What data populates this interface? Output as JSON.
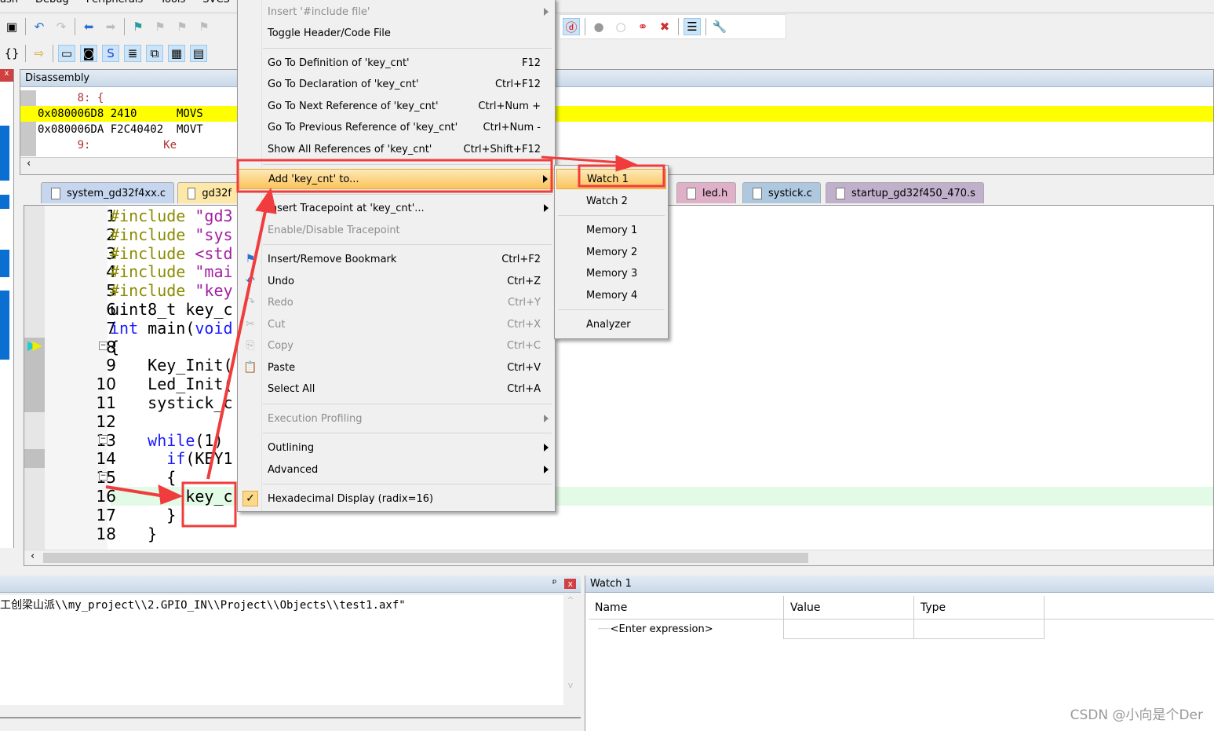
{
  "menubar": [
    "ash",
    "Debug",
    "Peripherals",
    "Tools",
    "SVCS"
  ],
  "disassembly": {
    "title": "Disassembly",
    "lines": [
      {
        "text": "      8: {",
        "style": "src"
      },
      {
        "text": "0x080006D8 2410      MOVS",
        "style": "current"
      },
      {
        "text": "0x080006DA F2C40402  MOVT",
        "style": "normal"
      },
      {
        "text": "      9:           Ke",
        "style": "src"
      }
    ]
  },
  "tabs": [
    {
      "label": "system_gd32f4xx.c",
      "color": "#c6d6ef"
    },
    {
      "label": "gd32f",
      "color": "#fde8a8"
    },
    {
      "label": "led.h",
      "color": "#dfb0c8"
    },
    {
      "label": "systick.c",
      "color": "#aec9df"
    },
    {
      "label": "startup_gd32f450_470.s",
      "color": "#c1b0cc"
    }
  ],
  "editor": {
    "lines": [
      {
        "n": "1",
        "parts": [
          [
            "pp",
            "#include "
          ],
          [
            "str",
            "\"gd3"
          ]
        ]
      },
      {
        "n": "2",
        "parts": [
          [
            "pp",
            "#include "
          ],
          [
            "str",
            "\"sys"
          ]
        ]
      },
      {
        "n": "3",
        "parts": [
          [
            "pp",
            "#include "
          ],
          [
            "str",
            "<std"
          ]
        ]
      },
      {
        "n": "4",
        "parts": [
          [
            "pp",
            "#include "
          ],
          [
            "str",
            "\"mai"
          ]
        ]
      },
      {
        "n": "5",
        "parts": [
          [
            "pp",
            "#include "
          ],
          [
            "str",
            "\"key"
          ]
        ]
      },
      {
        "n": "6",
        "parts": [
          [
            "",
            "uint8_t key_c"
          ]
        ]
      },
      {
        "n": "7",
        "parts": [
          [
            "kw",
            "int"
          ],
          [
            "",
            " main("
          ],
          [
            "kw",
            "void"
          ]
        ]
      },
      {
        "n": "8",
        "parts": [
          [
            "",
            "{"
          ]
        ]
      },
      {
        "n": "9",
        "parts": [
          [
            "",
            "    Key_Init("
          ]
        ]
      },
      {
        "n": "10",
        "parts": [
          [
            "",
            "    Led_Init("
          ]
        ]
      },
      {
        "n": "11",
        "parts": [
          [
            "",
            "    systick_c"
          ]
        ]
      },
      {
        "n": "12",
        "parts": [
          [
            "",
            ""
          ]
        ]
      },
      {
        "n": "13",
        "parts": [
          [
            "",
            "    "
          ],
          [
            "kw",
            "while"
          ],
          [
            "",
            "(1)"
          ]
        ]
      },
      {
        "n": "14",
        "parts": [
          [
            "",
            "      "
          ],
          [
            "kw",
            "if"
          ],
          [
            "",
            "(KEY1"
          ]
        ]
      },
      {
        "n": "15",
        "parts": [
          [
            "",
            "      {"
          ]
        ]
      },
      {
        "n": "16",
        "parts": [
          [
            "",
            "        key_c"
          ]
        ]
      },
      {
        "n": "17",
        "parts": [
          [
            "",
            "      }"
          ]
        ]
      },
      {
        "n": "18",
        "parts": [
          [
            "",
            "    }"
          ]
        ]
      }
    ]
  },
  "context_menu": {
    "items": [
      {
        "label": "Insert '#include file'",
        "shortcut": "",
        "disabled": true,
        "submenu": true
      },
      {
        "label": "Toggle Header/Code File",
        "shortcut": ""
      },
      {
        "label": "Go To Definition of 'key_cnt'",
        "shortcut": "F12"
      },
      {
        "label": "Go To Declaration of 'key_cnt'",
        "shortcut": "Ctrl+F12"
      },
      {
        "label": "Go To Next Reference of 'key_cnt'",
        "shortcut": "Ctrl+Num +"
      },
      {
        "label": "Go To Previous Reference of 'key_cnt'",
        "shortcut": "Ctrl+Num -"
      },
      {
        "label": "Show All References of 'key_cnt'",
        "shortcut": "Ctrl+Shift+F12"
      },
      {
        "label": "Add 'key_cnt' to...",
        "shortcut": "",
        "submenu": true,
        "highlighted": true
      },
      {
        "label": "Insert Tracepoint at 'key_cnt'...",
        "shortcut": "",
        "submenu": true
      },
      {
        "label": "Enable/Disable Tracepoint",
        "shortcut": "",
        "disabled": true
      },
      {
        "label": "Insert/Remove Bookmark",
        "shortcut": "Ctrl+F2",
        "icon": "bookmark-icon"
      },
      {
        "label": "Undo",
        "shortcut": "Ctrl+Z",
        "icon": "undo-icon"
      },
      {
        "label": "Redo",
        "shortcut": "Ctrl+Y",
        "disabled": true,
        "icon": "redo-icon"
      },
      {
        "label": "Cut",
        "shortcut": "Ctrl+X",
        "disabled": true,
        "icon": "cut-icon"
      },
      {
        "label": "Copy",
        "shortcut": "Ctrl+C",
        "disabled": true,
        "icon": "copy-icon"
      },
      {
        "label": "Paste",
        "shortcut": "Ctrl+V",
        "icon": "paste-icon"
      },
      {
        "label": "Select All",
        "shortcut": "Ctrl+A"
      },
      {
        "label": "Execution Profiling",
        "shortcut": "",
        "disabled": true,
        "submenu": true
      },
      {
        "label": "Outlining",
        "shortcut": "",
        "submenu": true
      },
      {
        "label": "Advanced",
        "shortcut": "",
        "submenu": true
      },
      {
        "label": "Hexadecimal Display (radix=16)",
        "shortcut": "",
        "checked": true
      }
    ]
  },
  "submenu": {
    "items": [
      "Watch 1",
      "Watch 2",
      "Memory 1",
      "Memory 2",
      "Memory 3",
      "Memory 4",
      "Analyzer"
    ],
    "highlighted": "Watch 1"
  },
  "command": {
    "text": "工创梁山派\\\\my_project\\\\2.GPIO_IN\\\\Project\\\\Objects\\\\test1.axf\""
  },
  "watch": {
    "title": "Watch 1",
    "columns": [
      "Name",
      "Value",
      "Type"
    ],
    "rows": [
      {
        "name": "<Enter expression>",
        "value": "",
        "type": ""
      }
    ]
  },
  "watermark": "CSDN @小向是个Der",
  "colors": {
    "annotation": "#f03c3c",
    "current_line": "#ffff00",
    "menu_highlight": "#fbc35a"
  }
}
